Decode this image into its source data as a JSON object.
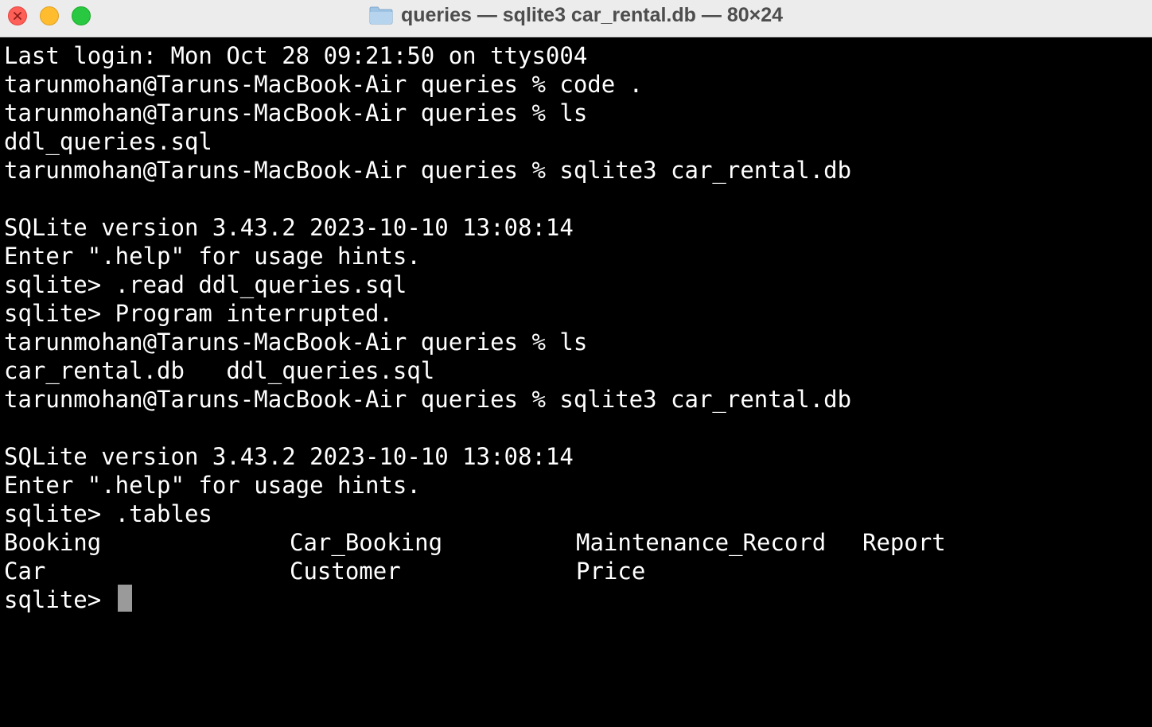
{
  "window": {
    "title": "queries — sqlite3 car_rental.db — 80×24",
    "colors": {
      "close": "#fe5f57",
      "minimize": "#febc2e",
      "zoom": "#28c840",
      "terminal_bg": "#000000",
      "terminal_fg": "#ffffff",
      "cursor": "#9a9a9a"
    }
  },
  "terminal": {
    "lines": [
      "Last login: Mon Oct 28 09:21:50 on ttys004",
      "tarunmohan@Taruns-MacBook-Air queries % code .",
      "tarunmohan@Taruns-MacBook-Air queries % ls",
      "ddl_queries.sql",
      "tarunmohan@Taruns-MacBook-Air queries % sqlite3 car_rental.db",
      "",
      "SQLite version 3.43.2 2023-10-10 13:08:14",
      "Enter \".help\" for usage hints.",
      "sqlite> .read ddl_queries.sql",
      "sqlite> Program interrupted.",
      "tarunmohan@Taruns-MacBook-Air queries % ls",
      "car_rental.db   ddl_queries.sql",
      "tarunmohan@Taruns-MacBook-Air queries % sqlite3 car_rental.db",
      "",
      "SQLite version 3.43.2 2023-10-10 13:08:14",
      "Enter \".help\" for usage hints.",
      "sqlite> .tables"
    ],
    "tables_row1": [
      "Booking",
      "Car_Booking",
      "Maintenance_Record",
      "Report"
    ],
    "tables_row2": [
      "Car",
      "Customer",
      "Price"
    ],
    "prompt": "sqlite> "
  },
  "icons": {
    "close": "close-icon",
    "title_folder": "folder-icon"
  }
}
